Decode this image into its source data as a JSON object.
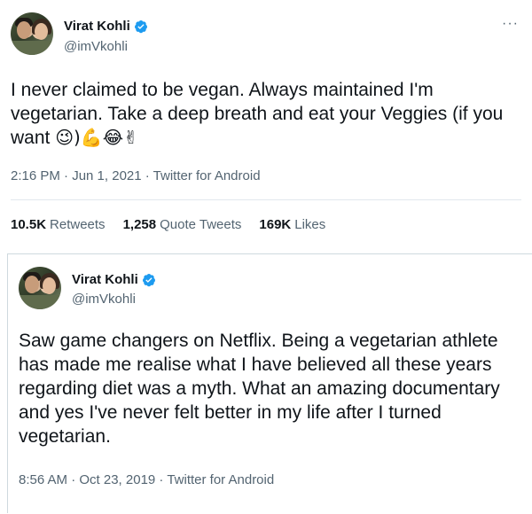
{
  "tweet1": {
    "name": "Virat Kohli",
    "handle": "@imVkohli",
    "more": "···",
    "text": "I never claimed to be vegan. Always maintained I'm vegetarian. Take a deep breath and eat your Veggies (if you want",
    "emojis": "😉)💪😂✌",
    "timestamp": "2:16 PM · Jun 1, 2021 · Twitter for Android",
    "stats": {
      "retweets_count": "10.5K",
      "retweets_label": "Retweets",
      "quotes_count": "1,258",
      "quotes_label": "Quote Tweets",
      "likes_count": "169K",
      "likes_label": "Likes"
    }
  },
  "tweet2": {
    "name": "Virat Kohli",
    "handle": "@imVkohli",
    "text": "Saw game changers on Netflix. Being a vegetarian athlete has made me realise what I have believed all these years regarding diet was a myth. What an amazing documentary and yes I've never felt better in my life after I turned vegetarian.",
    "timestamp": "8:56 AM · Oct 23, 2019 · Twitter for Android"
  },
  "icons": {
    "verified": "verified-badge-icon",
    "more": "more-options-icon"
  },
  "colors": {
    "verified": "#1d9bf0",
    "secondary_text": "#536471",
    "divider": "#e1e8ed"
  }
}
